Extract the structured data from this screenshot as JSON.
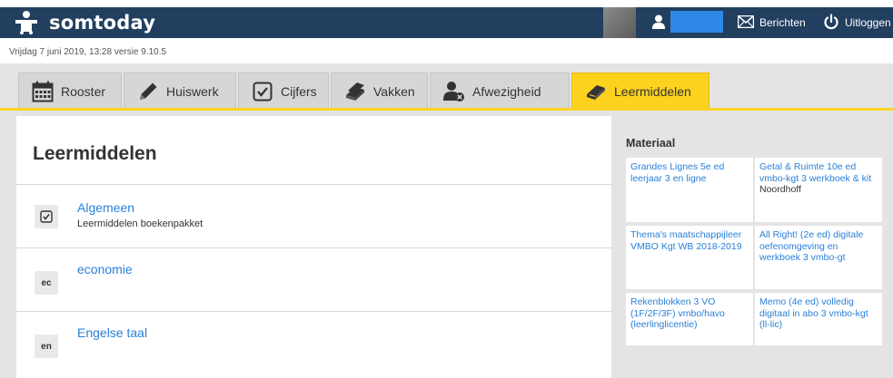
{
  "header": {
    "logo_text": "somtoday",
    "user_name": "",
    "messages_label": "Berichten",
    "logout_label": "Uitloggen"
  },
  "status": {
    "line": "Vrijdag 7 juni 2019, 13:28 versie 9.10.5"
  },
  "tabs": [
    {
      "label": "Rooster",
      "icon": "calendar-icon"
    },
    {
      "label": "Huiswerk",
      "icon": "pencil-icon"
    },
    {
      "label": "Cijfers",
      "icon": "checkbox-icon"
    },
    {
      "label": "Vakken",
      "icon": "books-icon"
    },
    {
      "label": "Afwezigheid",
      "icon": "user-absence-icon"
    },
    {
      "label": "Leermiddelen",
      "icon": "book-icon",
      "active": true
    }
  ],
  "main": {
    "title": "Leermiddelen",
    "courses": [
      {
        "badge": "",
        "icon": "checkbox-icon",
        "name": "Algemeen",
        "subtitle": "Leermiddelen boekenpakket"
      },
      {
        "badge": "ec",
        "name": "economie",
        "subtitle": ""
      },
      {
        "badge": "en",
        "name": "Engelse taal",
        "subtitle": ""
      }
    ]
  },
  "materials": {
    "title": "Materiaal",
    "items": [
      {
        "title": "Grandes Lignes 5e ed leerjaar 3 en ligne",
        "publisher": ""
      },
      {
        "title": "Getal & Ruimte 10e ed vmbo-kgt 3 werkboek & kit",
        "publisher": "Noordhoff"
      },
      {
        "title": "Thema's maatschappijleer VMBO Kgt WB 2018-2019",
        "publisher": ""
      },
      {
        "title": "All Right! (2e ed) digitale oefenomgeving en werkboek 3 vmbo-gt",
        "publisher": ""
      },
      {
        "title": "Rekenblokken 3 VO (1F/2F/3F) vmbo/havo (leerlinglicentie)",
        "publisher": ""
      },
      {
        "title": "Memo (4e ed) volledig digitaal in abo 3 vmbo-kgt (ll-lic)",
        "publisher": ""
      }
    ]
  },
  "colors": {
    "header_bg": "#223f5f",
    "accent_yellow": "#fcd21f",
    "link_blue": "#2a80d8",
    "user_box_blue": "#2f88e6"
  }
}
